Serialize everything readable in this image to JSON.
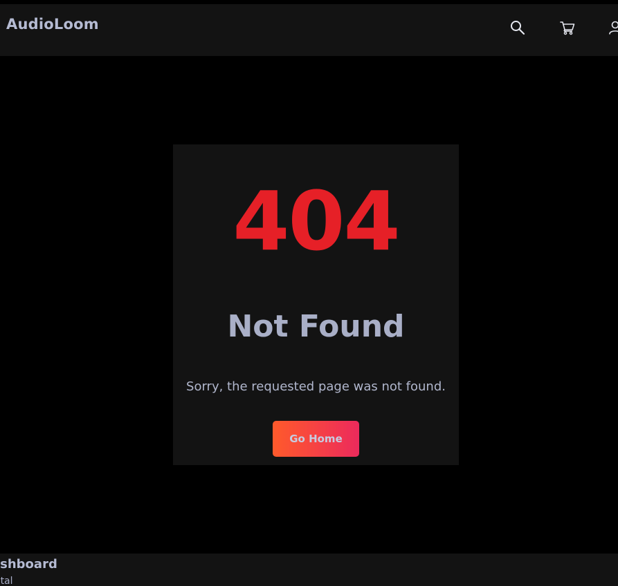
{
  "header": {
    "brand": "AudioLoom",
    "icons": [
      "search-icon",
      "cart-icon",
      "user-icon"
    ]
  },
  "error_card": {
    "code": "404",
    "title": "Not Found",
    "message": "Sorry, the requested page was not found.",
    "button_label": "Go Home"
  },
  "bottom_panel": {
    "title": "ashboard",
    "subtitle": "otal"
  },
  "colors": {
    "background": "#000000",
    "surface": "#131313",
    "error_red": "#e62027",
    "text_muted": "#a9afc7",
    "button_gradient_start": "#ff5a2b",
    "button_gradient_end": "#ec2a5c"
  }
}
